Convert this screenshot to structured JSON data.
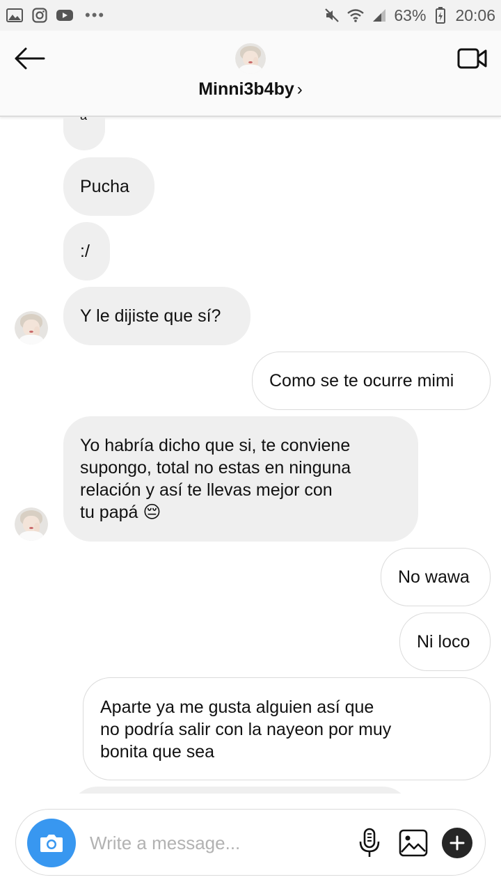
{
  "status_bar": {
    "left_icons": [
      "gallery-icon",
      "instagram-icon",
      "youtube-icon"
    ],
    "more": "•••",
    "battery": "63%",
    "time": "20:06"
  },
  "header": {
    "username": "Minni3b4by",
    "chevron": "›"
  },
  "messages": [
    {
      "side": "in",
      "text": "a",
      "partial": true
    },
    {
      "side": "in",
      "text": "Pucha"
    },
    {
      "side": "in",
      "text": ":/"
    },
    {
      "side": "in",
      "text": "Y le dijiste que sí?",
      "avatar": true
    },
    {
      "side": "out",
      "text": "Como se te ocurre mimi"
    },
    {
      "side": "in",
      "lines": [
        "Yo habría dicho que si, te conviene",
        "supongo, total no estas en ninguna",
        "relación y así te llevas mejor con",
        "tu papá 😔"
      ],
      "avatar": true
    },
    {
      "side": "out",
      "text": "No wawa"
    },
    {
      "side": "out",
      "text": "Ni loco"
    },
    {
      "side": "out",
      "lines": [
        "Aparte ya me gusta alguien así que",
        "no podría salir con la nayeon por muy",
        "bonita que sea"
      ]
    }
  ],
  "composer": {
    "placeholder": "Write a message..."
  },
  "colors": {
    "accent": "#3897f0",
    "incoming_bubble": "#efefef",
    "outgoing_border": "#dbdbdb"
  }
}
